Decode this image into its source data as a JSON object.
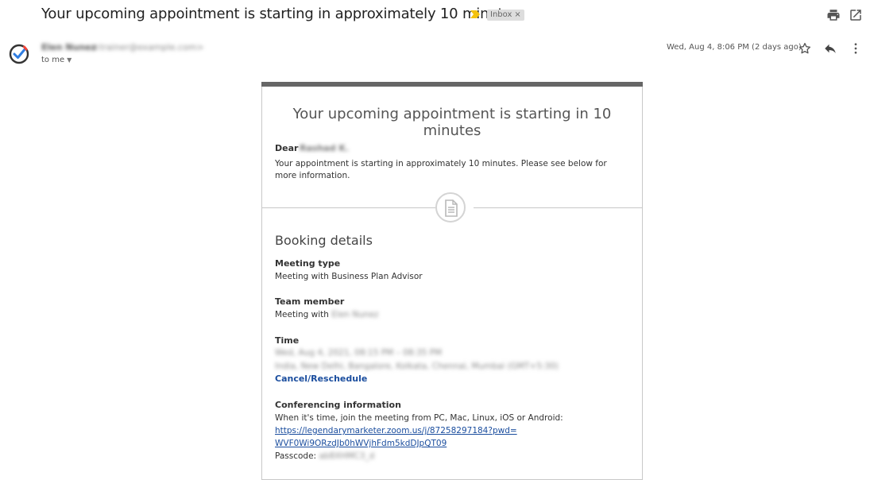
{
  "header": {
    "subject": "Your upcoming appointment is starting in approximately 10 minutes",
    "label_chip": "Inbox",
    "label_remove": "×",
    "colors": {
      "importance": "#f4c20d"
    }
  },
  "sender": {
    "name": "Elen Nunez",
    "email": "<trainer@example.com>",
    "to_me": "to me",
    "date": "Wed, Aug 4, 8:06 PM (2 days ago)"
  },
  "icons": {
    "print": "print-icon",
    "open_new": "open-in-new-icon",
    "star": "star-icon",
    "reply": "reply-icon",
    "more": "more-vert-icon",
    "document": "document-icon"
  },
  "email": {
    "title": "Your upcoming appointment is starting in 10 minutes",
    "dear_label": "Dear",
    "dear_name": "Rashad K.",
    "intro": "Your appointment is starting in approximately 10 minutes. Please see below for more information.",
    "booking_title": "Booking details",
    "meeting_type_label": "Meeting type",
    "meeting_type_value": "Meeting with Business Plan Advisor",
    "team_member_label": "Team member",
    "team_member_prefix": "Meeting with",
    "team_member_name": "Elen Nunez",
    "time_label": "Time",
    "time_line1": "Wed, Aug 4, 2021, 08:15 PM – 08:35 PM",
    "time_line2": "India, New Delhi, Bangalore, Kolkata, Chennai, Mumbai (GMT+5:30)",
    "cancel_reschedule": "Cancel/Reschedule",
    "conferencing_label": "Conferencing information",
    "conferencing_text": "When it's time, join the meeting from PC, Mac, Linux, iOS or Android:",
    "zoom_link_line1": "https://legendarymarketer.zoom.us/j/87258297184?pwd=",
    "zoom_link_line2": "WVF0Wi9ORzdJb0hWVjhFdm5kdDJpQT09",
    "passcode_label": "Passcode:",
    "passcode_value": "ab8XHMC3_d"
  }
}
